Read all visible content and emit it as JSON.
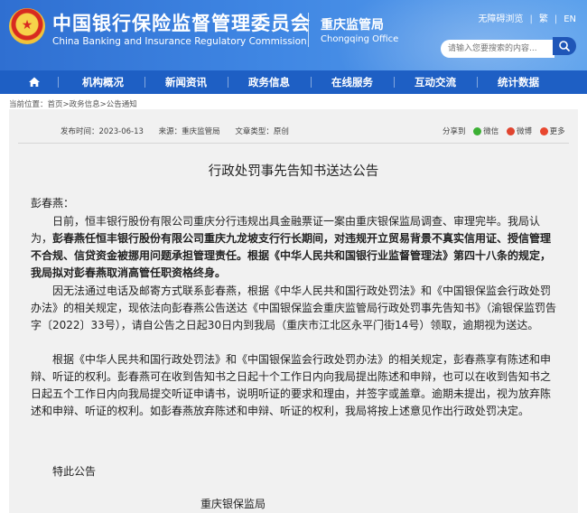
{
  "header": {
    "org_name_cn": "中国银行保险监督管理委员会",
    "org_name_en": "China Banking and Insurance Regulatory Commission",
    "branch_cn": "重庆监管局",
    "branch_en": "Chongqing Office",
    "util_links": [
      "无障碍浏览",
      "繁",
      "EN"
    ],
    "search_placeholder": "请输入您要搜索的内容...",
    "emblem_glyph": "★"
  },
  "nav": {
    "home_icon": "home-icon",
    "items": [
      "机构概况",
      "新闻资讯",
      "政务信息",
      "在线服务",
      "互动交流",
      "统计数据"
    ]
  },
  "breadcrumb": {
    "prefix": "当前位置：",
    "path": [
      "首页",
      "政务信息",
      "公告通知"
    ],
    "separator": " > "
  },
  "article": {
    "meta": {
      "date": "发布时间：2023-06-13",
      "source": "来源：重庆监管局",
      "type": "文章类型：原创"
    },
    "share": {
      "labels": [
        "分享到",
        "微信",
        "微博",
        "更多"
      ]
    },
    "title": "行政处罚事先告知书送达公告",
    "addressee": "彭春燕：",
    "p1_normal": "日前，恒丰银行股份有限公司重庆分行违规出具金融票证一案由重庆银保监局调查、审理完毕。我局认为，",
    "p1_bold": "彭春燕任恒丰银行股份有限公司重庆九龙坡支行行长期间，对违规开立贸易背景不真实信用证、授信管理不合规、信贷资金被挪用问题承担管理责任。根据《中华人民共和国银行业监督管理法》第四十八条的规定，我局拟对彭春燕取消高管任职资格终身。",
    "p2": "因无法通过电话及邮寄方式联系彭春燕，根据《中华人民共和国行政处罚法》和《中国银保监会行政处罚办法》的相关规定，现依法向彭春燕公告送达《中国银保监会重庆监管局行政处罚事先告知书》（渝银保监罚告字〔2022〕33号），请自公告之日起30日内到我局（重庆市江北区永平门街14号）领取，逾期视为送达。",
    "p3": "根据《中华人民共和国行政处罚法》和《中国银保监会行政处罚办法》的相关规定，彭春燕享有陈述和申辩、听证的权利。彭春燕可在收到告知书之日起十个工作日内向我局提出陈述和申辩，也可以在收到告知书之日起五个工作日内向我局提交听证申请书，说明听证的要求和理由，并签字或盖章。逾期未提出，视为放弃陈述和申辩、听证的权利。如彭春燕放弃陈述和申辩、听证的权利，我局将按上述意见作出行政处罚决定。",
    "closing": "特此公告",
    "signature": "重庆银保监局"
  },
  "colors": {
    "header_blue": "#3f86e3",
    "nav_blue": "#1e5fc4",
    "panel_bg": "#f1f1f1",
    "wechat_green": "#3cb034",
    "weibo_red": "#e0442f",
    "more_red": "#e8472f"
  }
}
